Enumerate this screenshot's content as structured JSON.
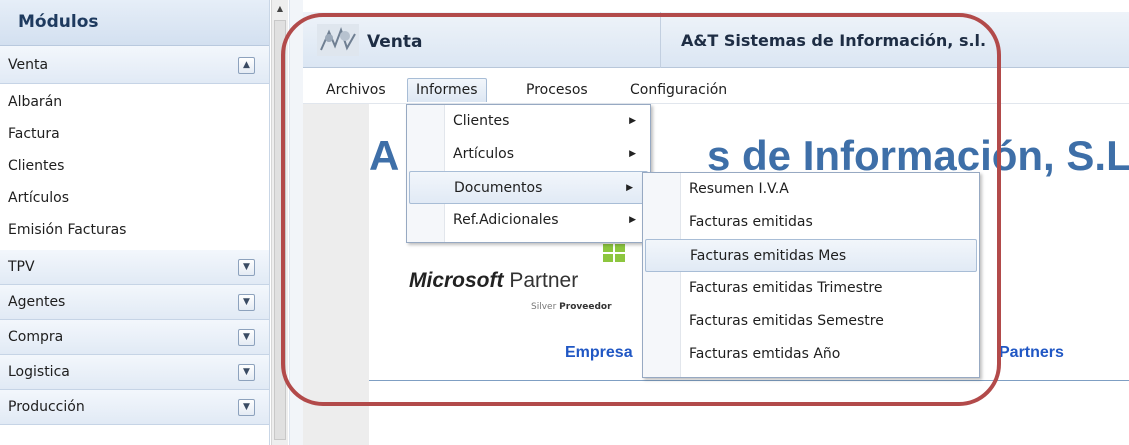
{
  "sidebar": {
    "title": "Módulos",
    "open_module": "Venta",
    "sub_items": [
      "Albarán",
      "Factura",
      "Clientes",
      "Artículos",
      "Emisión Facturas"
    ],
    "modules": [
      "TPV",
      "Agentes",
      "Compra",
      "Logistica",
      "Producción"
    ]
  },
  "header": {
    "module_title": "Venta",
    "company": "A&T Sistemas de Información, s.l."
  },
  "menubar": {
    "items": [
      "Archivos",
      "Informes",
      "Procesos",
      "Configuración"
    ],
    "active": "Informes"
  },
  "informes_menu": [
    "Clientes",
    "Artículos",
    "Documentos",
    "Ref.Adicionales"
  ],
  "documentos_menu": [
    "Resumen I.V.A",
    "Facturas emitidas",
    "Facturas emitidas Mes",
    "Facturas emitidas Trimestre",
    "Facturas emitidas Semestre",
    "Facturas emtidas Año"
  ],
  "background": {
    "heading_start": "A",
    "heading_end": "s de Información, S.L.",
    "ms_logo": "Microsoft",
    "ms_partner": "Partner",
    "ms_silver": "Silver",
    "ms_proveedor": "Proveedor",
    "link_empresa": "Empresa",
    "link_partners": "Partners"
  },
  "colors": {
    "accent": "#3e6fa8",
    "link": "#2057c4",
    "highlight_ring": "#b24a4a"
  }
}
